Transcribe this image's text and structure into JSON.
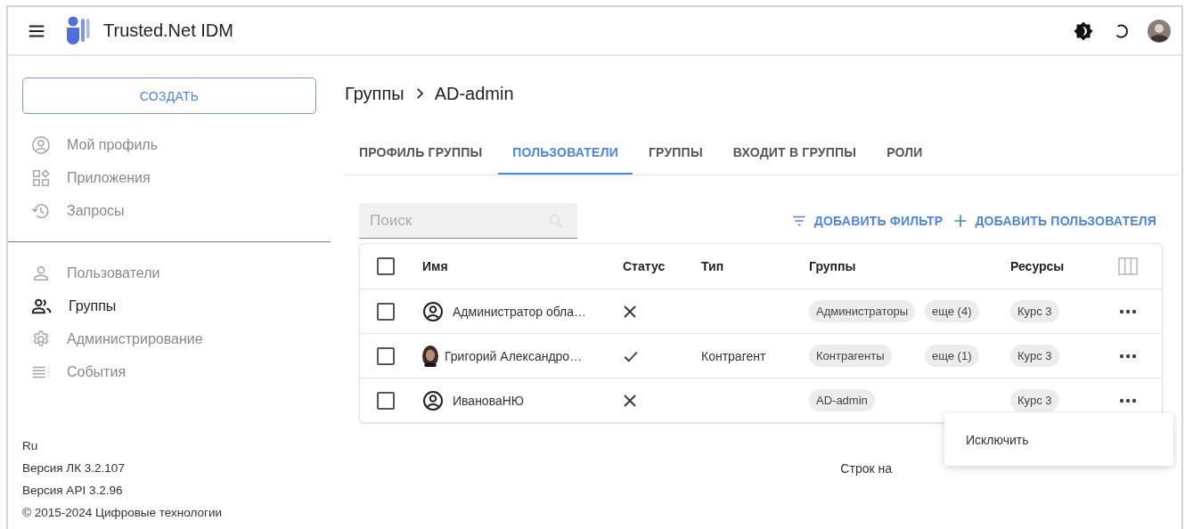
{
  "app": {
    "title": "Trusted.Net IDM"
  },
  "sidebar": {
    "create_button": "СОЗДАТЬ",
    "nav_top": [
      {
        "label": "Мой профиль",
        "selected": false
      },
      {
        "label": "Приложения",
        "selected": false
      },
      {
        "label": "Запросы",
        "selected": false
      }
    ],
    "nav_bottom": [
      {
        "label": "Пользователи",
        "selected": false
      },
      {
        "label": "Группы",
        "selected": true
      },
      {
        "label": "Администрирование",
        "selected": false
      },
      {
        "label": "События",
        "selected": false
      }
    ],
    "footer": [
      "Ru",
      "Версия ЛК 3.2.107",
      "Версия API 3.2.96",
      "© 2015-2024 Цифровые технологии"
    ]
  },
  "breadcrumb": [
    "Группы",
    "AD-admin"
  ],
  "tabs": [
    {
      "label": "ПРОФИЛЬ ГРУППЫ",
      "selected": false
    },
    {
      "label": "ПОЛЬЗОВАТЕЛИ",
      "selected": true
    },
    {
      "label": "ГРУППЫ",
      "selected": false
    },
    {
      "label": "ВХОДИТ В ГРУППЫ",
      "selected": false
    },
    {
      "label": "РОЛИ",
      "selected": false
    }
  ],
  "search": {
    "placeholder": "Поиск"
  },
  "actions": [
    "ДОБАВИТЬ ФИЛЬТР",
    "ДОБАВИТЬ ПОЛЬЗОВАТЕЛЯ"
  ],
  "table": {
    "header_checked": false,
    "columns": [
      "Имя",
      "Статус",
      "Тип",
      "Группы",
      "Ресурсы"
    ],
    "rows": [
      {
        "checked": false,
        "kind": "default",
        "name": "Администратор обла…",
        "active": false,
        "groups": [
          "Администраторы",
          "еще (4)"
        ],
        "resources": [
          "Курс 3"
        ]
      },
      {
        "checked": false,
        "kind": "photo",
        "name": "Григорий Александро…",
        "active": true,
        "type": "Контрагент",
        "groups": [
          "Контрагенты",
          "еще (1)"
        ],
        "resources": [
          "Курс 3"
        ]
      },
      {
        "checked": false,
        "kind": "default",
        "name": "ИвановаНЮ",
        "active": false,
        "groups": [
          "AD-admin"
        ],
        "resources": [
          "Курс 3"
        ]
      }
    ]
  },
  "pagination": {
    "rows_label": "Строк на"
  },
  "context_menu": {
    "items": [
      "Исключить"
    ]
  }
}
